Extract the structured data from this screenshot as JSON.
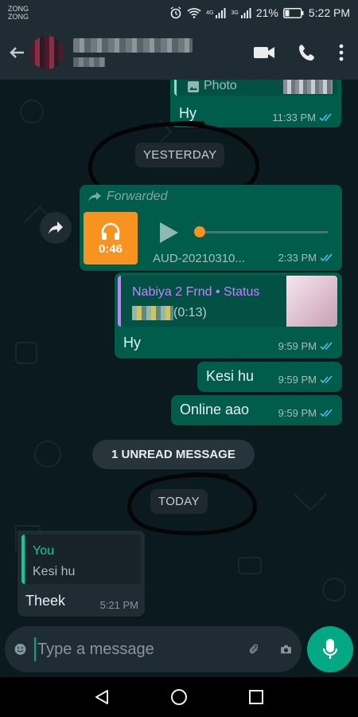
{
  "status_bar": {
    "carrier_line1": "ZONG",
    "carrier_line2": "ZONG",
    "battery": "21%",
    "time": "5:22 PM",
    "net_1": "4G",
    "net_2": "3G"
  },
  "header": {
    "contact_name": "",
    "icons": [
      "back-arrow-icon",
      "video-call-icon",
      "voice-call-icon",
      "more-options-icon"
    ]
  },
  "messages": {
    "photo_label": "Photo",
    "hy_text": "Hy",
    "hy_time": "11:33 PM",
    "yesterday_label": "YESTERDAY",
    "forwarded_label": "Forwarded",
    "audio_duration": "0:46",
    "audio_file_name": "AUD-20210310...",
    "audio_time": "2:33 PM",
    "reply_status_title": "Nabiya 2 Frnd • Status",
    "reply_status_duration": "(0:13)",
    "reply_msg_text": "Hy",
    "reply_msg_time": "9:59 PM",
    "kesi_text": "Kesi hu",
    "kesi_time": "9:59 PM",
    "online_text": "Online aao",
    "online_time": "9:59 PM",
    "unread_label": "1 UNREAD MESSAGE",
    "today_label": "TODAY",
    "quote_author": "You",
    "quote_text": "Kesi hu",
    "theek_text": "Theek",
    "theek_time": "5:21 PM"
  },
  "composer": {
    "placeholder": "Type a message",
    "value": ""
  },
  "colors": {
    "accent": "#00a884",
    "outgoing_bubble": "#005c4b",
    "incoming_bubble": "#1f2c34",
    "read_ticks": "#53bdeb",
    "audio_thumb": "#f7931e",
    "status_reply_name": "#c084fc"
  }
}
